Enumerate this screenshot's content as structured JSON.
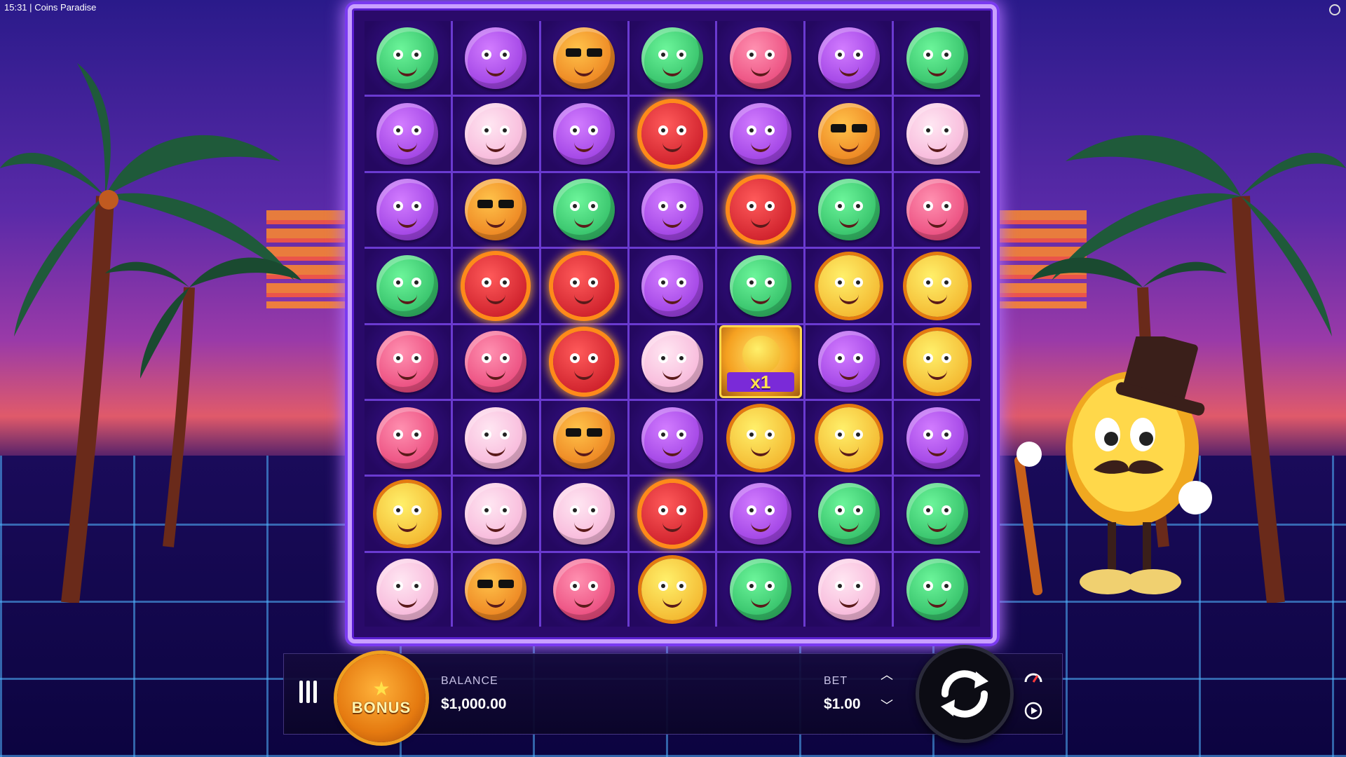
{
  "status": {
    "time": "15:31",
    "separator": "|",
    "title": "Coins Paradise"
  },
  "grid": [
    [
      "green",
      "purple",
      "orange",
      "green",
      "pink",
      "purple",
      "green"
    ],
    [
      "purple",
      "lightpink",
      "purple",
      "red",
      "purple",
      "orange",
      "lightpink"
    ],
    [
      "purple",
      "orange",
      "green",
      "purple",
      "red",
      "green",
      "pink"
    ],
    [
      "green",
      "red",
      "red",
      "purple",
      "green",
      "yellow",
      "yellow"
    ],
    [
      "pink",
      "pink",
      "red",
      "lightpink",
      "special",
      "purple",
      "yellow"
    ],
    [
      "pink",
      "lightpink",
      "orange",
      "purple",
      "yellow",
      "yellow",
      "purple"
    ],
    [
      "yellow",
      "lightpink",
      "lightpink",
      "red",
      "purple",
      "green",
      "green"
    ],
    [
      "lightpink",
      "orange",
      "pink",
      "yellow",
      "green",
      "lightpink",
      "green"
    ]
  ],
  "special_symbol": {
    "multiplier": "x1"
  },
  "controls": {
    "bonus_label": "BONUS",
    "balance_label": "BALANCE",
    "balance_value": "$1,000.00",
    "bet_label": "BET",
    "bet_value": "$1.00"
  },
  "icons": {
    "menu": "menu-icon",
    "bet_up": "chevron-up-icon",
    "bet_down": "chevron-down-icon",
    "spin": "spin-icon",
    "turbo": "speedometer-icon",
    "autoplay": "autoplay-icon"
  }
}
